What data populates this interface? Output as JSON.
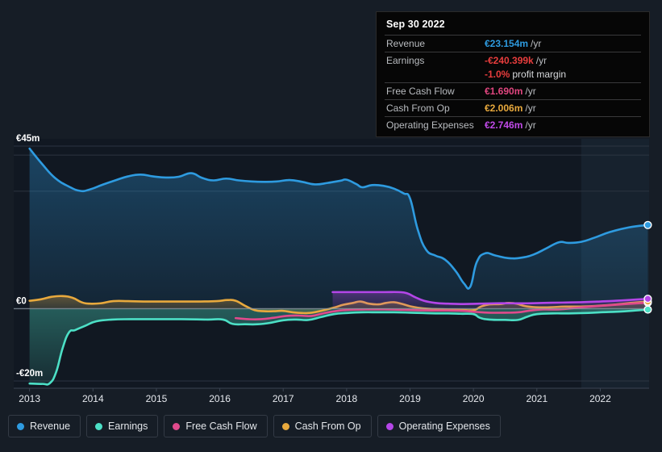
{
  "chart_data": {
    "type": "area",
    "title": "",
    "xlabel": "",
    "ylabel": "",
    "currency": "EUR",
    "grid": true,
    "legend_position": "bottom",
    "xlim": [
      2012.75,
      2022.77
    ],
    "ylim": [
      -22.0,
      47.0
    ],
    "y_ticks": [
      {
        "value": 45,
        "label": "€45m"
      },
      {
        "value": 0,
        "label": "€0"
      },
      {
        "value": -20,
        "label": "-€20m"
      }
    ],
    "gridline_values": [
      45,
      42.5,
      32.5,
      0,
      -20
    ],
    "x_ticks": [
      "2013",
      "2014",
      "2015",
      "2016",
      "2017",
      "2018",
      "2019",
      "2020",
      "2021",
      "2022"
    ],
    "forecast_region": {
      "start": 2021.7,
      "end": 2022.77
    },
    "series": [
      {
        "name": "Revenue",
        "key": "revenue",
        "color": "#2e9be0",
        "fill": true,
        "endpoint": true,
        "points": [
          [
            2013.0,
            44.3
          ],
          [
            2013.2,
            40.0
          ],
          [
            2013.4,
            36.2
          ],
          [
            2013.62,
            33.8
          ],
          [
            2013.8,
            32.6
          ],
          [
            2013.95,
            33.0
          ],
          [
            2014.15,
            34.3
          ],
          [
            2014.35,
            35.5
          ],
          [
            2014.55,
            36.6
          ],
          [
            2014.75,
            37.1
          ],
          [
            2014.95,
            36.6
          ],
          [
            2015.15,
            36.3
          ],
          [
            2015.35,
            36.5
          ],
          [
            2015.55,
            37.5
          ],
          [
            2015.72,
            36.2
          ],
          [
            2015.9,
            35.5
          ],
          [
            2016.1,
            36.0
          ],
          [
            2016.3,
            35.5
          ],
          [
            2016.5,
            35.2
          ],
          [
            2016.7,
            35.1
          ],
          [
            2016.9,
            35.2
          ],
          [
            2017.1,
            35.6
          ],
          [
            2017.3,
            35.1
          ],
          [
            2017.5,
            34.4
          ],
          [
            2017.7,
            34.8
          ],
          [
            2017.9,
            35.4
          ],
          [
            2018.0,
            35.7
          ],
          [
            2018.15,
            34.5
          ],
          [
            2018.25,
            33.6
          ],
          [
            2018.4,
            34.2
          ],
          [
            2018.58,
            34.0
          ],
          [
            2018.75,
            33.2
          ],
          [
            2018.9,
            31.9
          ],
          [
            2019.0,
            30.5
          ],
          [
            2019.12,
            22.0
          ],
          [
            2019.25,
            16.4
          ],
          [
            2019.4,
            14.7
          ],
          [
            2019.55,
            13.6
          ],
          [
            2019.72,
            10.4
          ],
          [
            2019.85,
            7.0
          ],
          [
            2019.95,
            6.1
          ],
          [
            2020.05,
            12.8
          ],
          [
            2020.18,
            15.3
          ],
          [
            2020.35,
            14.7
          ],
          [
            2020.55,
            14.0
          ],
          [
            2020.75,
            14.1
          ],
          [
            2020.95,
            15.0
          ],
          [
            2021.15,
            16.7
          ],
          [
            2021.35,
            18.4
          ],
          [
            2021.5,
            18.2
          ],
          [
            2021.7,
            18.5
          ],
          [
            2021.9,
            19.6
          ],
          [
            2022.15,
            21.2
          ],
          [
            2022.45,
            22.5
          ],
          [
            2022.75,
            23.154
          ]
        ]
      },
      {
        "name": "Earnings",
        "key": "earnings",
        "color": "#4ce0c6",
        "fill": true,
        "endpoint": true,
        "points": [
          [
            2013.0,
            -20.7
          ],
          [
            2013.2,
            -20.8
          ],
          [
            2013.32,
            -20.6
          ],
          [
            2013.42,
            -17.5
          ],
          [
            2013.52,
            -11.0
          ],
          [
            2013.62,
            -6.6
          ],
          [
            2013.72,
            -5.9
          ],
          [
            2013.88,
            -4.7
          ],
          [
            2014.05,
            -3.5
          ],
          [
            2014.3,
            -3.0
          ],
          [
            2014.6,
            -2.9
          ],
          [
            2015.0,
            -2.9
          ],
          [
            2015.4,
            -2.9
          ],
          [
            2015.8,
            -3.0
          ],
          [
            2016.05,
            -3.0
          ],
          [
            2016.2,
            -4.2
          ],
          [
            2016.4,
            -4.3
          ],
          [
            2016.6,
            -4.3
          ],
          [
            2016.8,
            -3.9
          ],
          [
            2017.0,
            -3.2
          ],
          [
            2017.2,
            -3.0
          ],
          [
            2017.4,
            -3.1
          ],
          [
            2017.6,
            -2.3
          ],
          [
            2017.8,
            -1.5
          ],
          [
            2018.0,
            -1.2
          ],
          [
            2018.25,
            -1.0
          ],
          [
            2018.5,
            -1.0
          ],
          [
            2018.75,
            -1.0
          ],
          [
            2019.0,
            -1.1
          ],
          [
            2019.2,
            -1.2
          ],
          [
            2019.4,
            -1.3
          ],
          [
            2019.6,
            -1.3
          ],
          [
            2019.8,
            -1.4
          ],
          [
            2020.0,
            -1.5
          ],
          [
            2020.1,
            -2.5
          ],
          [
            2020.25,
            -3.0
          ],
          [
            2020.5,
            -3.1
          ],
          [
            2020.7,
            -3.1
          ],
          [
            2020.85,
            -2.2
          ],
          [
            2021.0,
            -1.5
          ],
          [
            2021.25,
            -1.3
          ],
          [
            2021.5,
            -1.3
          ],
          [
            2021.75,
            -1.2
          ],
          [
            2022.0,
            -1.0
          ],
          [
            2022.3,
            -0.8
          ],
          [
            2022.55,
            -0.5
          ],
          [
            2022.75,
            -0.240399
          ]
        ]
      },
      {
        "name": "Free Cash Flow",
        "key": "free_cash_flow",
        "color": "#e04a8c",
        "fill": false,
        "endpoint": true,
        "points": [
          [
            2016.25,
            -2.6
          ],
          [
            2016.45,
            -2.9
          ],
          [
            2016.65,
            -2.9
          ],
          [
            2016.85,
            -2.5
          ],
          [
            2017.05,
            -2.0
          ],
          [
            2017.25,
            -1.9
          ],
          [
            2017.45,
            -2.0
          ],
          [
            2017.65,
            -1.2
          ],
          [
            2017.85,
            -0.6
          ],
          [
            2018.05,
            -0.3
          ],
          [
            2018.3,
            -0.2
          ],
          [
            2018.6,
            -0.2
          ],
          [
            2018.85,
            -0.3
          ],
          [
            2019.1,
            -0.4
          ],
          [
            2019.35,
            -0.5
          ],
          [
            2019.6,
            -0.5
          ],
          [
            2019.85,
            -0.6
          ],
          [
            2020.05,
            -0.9
          ],
          [
            2020.25,
            -1.1
          ],
          [
            2020.5,
            -1.1
          ],
          [
            2020.7,
            -1.0
          ],
          [
            2020.9,
            -0.5
          ],
          [
            2021.1,
            -0.2
          ],
          [
            2021.35,
            -0.2
          ],
          [
            2021.6,
            0.2
          ],
          [
            2021.85,
            0.6
          ],
          [
            2022.1,
            0.9
          ],
          [
            2022.4,
            1.3
          ],
          [
            2022.75,
            1.69
          ]
        ]
      },
      {
        "name": "Cash From Op",
        "key": "cash_from_op",
        "color": "#e8a93d",
        "fill": true,
        "endpoint": true,
        "points": [
          [
            2013.0,
            2.2
          ],
          [
            2013.18,
            2.6
          ],
          [
            2013.35,
            3.3
          ],
          [
            2013.52,
            3.5
          ],
          [
            2013.68,
            3.0
          ],
          [
            2013.82,
            1.8
          ],
          [
            2013.95,
            1.4
          ],
          [
            2014.12,
            1.5
          ],
          [
            2014.32,
            2.1
          ],
          [
            2014.55,
            2.1
          ],
          [
            2014.8,
            2.0
          ],
          [
            2015.1,
            2.0
          ],
          [
            2015.4,
            2.0
          ],
          [
            2015.7,
            2.0
          ],
          [
            2015.95,
            2.1
          ],
          [
            2016.12,
            2.4
          ],
          [
            2016.25,
            2.2
          ],
          [
            2016.4,
            0.8
          ],
          [
            2016.55,
            -0.4
          ],
          [
            2016.7,
            -0.7
          ],
          [
            2016.85,
            -0.7
          ],
          [
            2017.0,
            -0.6
          ],
          [
            2017.15,
            -1.0
          ],
          [
            2017.3,
            -1.2
          ],
          [
            2017.45,
            -1.1
          ],
          [
            2017.62,
            -0.5
          ],
          [
            2017.8,
            0.3
          ],
          [
            2017.95,
            1.1
          ],
          [
            2018.1,
            1.6
          ],
          [
            2018.22,
            2.0
          ],
          [
            2018.35,
            1.4
          ],
          [
            2018.5,
            1.2
          ],
          [
            2018.62,
            1.6
          ],
          [
            2018.75,
            1.8
          ],
          [
            2018.88,
            1.3
          ],
          [
            2019.02,
            0.6
          ],
          [
            2019.2,
            0.1
          ],
          [
            2019.4,
            -0.1
          ],
          [
            2019.6,
            -0.2
          ],
          [
            2019.8,
            -0.3
          ],
          [
            2020.0,
            -0.4
          ],
          [
            2020.12,
            0.6
          ],
          [
            2020.25,
            1.2
          ],
          [
            2020.42,
            1.3
          ],
          [
            2020.55,
            1.6
          ],
          [
            2020.68,
            1.4
          ],
          [
            2020.82,
            0.7
          ],
          [
            2021.0,
            0.4
          ],
          [
            2021.2,
            0.4
          ],
          [
            2021.45,
            0.6
          ],
          [
            2021.7,
            0.6
          ],
          [
            2021.95,
            0.8
          ],
          [
            2022.2,
            1.1
          ],
          [
            2022.48,
            1.6
          ],
          [
            2022.75,
            2.006
          ]
        ]
      },
      {
        "name": "Operating Expenses",
        "key": "operating_expenses",
        "color": "#b446e8",
        "fill": true,
        "endpoint": true,
        "points": [
          [
            2017.78,
            4.6
          ],
          [
            2018.0,
            4.6
          ],
          [
            2018.3,
            4.6
          ],
          [
            2018.6,
            4.6
          ],
          [
            2018.82,
            4.6
          ],
          [
            2018.95,
            4.3
          ],
          [
            2019.08,
            3.2
          ],
          [
            2019.22,
            2.2
          ],
          [
            2019.4,
            1.6
          ],
          [
            2019.6,
            1.4
          ],
          [
            2019.85,
            1.3
          ],
          [
            2020.1,
            1.4
          ],
          [
            2020.35,
            1.5
          ],
          [
            2020.6,
            1.5
          ],
          [
            2020.85,
            1.5
          ],
          [
            2021.1,
            1.6
          ],
          [
            2021.4,
            1.7
          ],
          [
            2021.7,
            1.8
          ],
          [
            2022.0,
            2.0
          ],
          [
            2022.35,
            2.3
          ],
          [
            2022.75,
            2.746
          ]
        ]
      }
    ]
  },
  "tooltip": {
    "title": "Sep 30 2022",
    "rows": [
      {
        "label": "Revenue",
        "value": "€23.154m",
        "unit": "/yr",
        "color": "#2e9be0"
      },
      {
        "label": "Earnings",
        "value": "-€240.399k",
        "unit": "/yr",
        "color": "#e83d3d"
      },
      {
        "label": "",
        "value": "-1.0%",
        "suffix": "profit margin",
        "color": "#e83d3d"
      },
      {
        "label": "Free Cash Flow",
        "value": "€1.690m",
        "unit": "/yr",
        "color": "#e0467f"
      },
      {
        "label": "Cash From Op",
        "value": "€2.006m",
        "unit": "/yr",
        "color": "#e8a93d"
      },
      {
        "label": "Operating Expenses",
        "value": "€2.746m",
        "unit": "/yr",
        "color": "#c04ae8"
      }
    ]
  },
  "legend": {
    "items": [
      {
        "label": "Revenue",
        "color": "#2e9be0"
      },
      {
        "label": "Earnings",
        "color": "#4ce0c6"
      },
      {
        "label": "Free Cash Flow",
        "color": "#e04a8c"
      },
      {
        "label": "Cash From Op",
        "color": "#e8a93d"
      },
      {
        "label": "Operating Expenses",
        "color": "#b446e8"
      }
    ]
  },
  "theme": {
    "background": "#161d26",
    "plot_background": "#111822",
    "gridline": "#2c3541",
    "zero_line": "#8f9aa6",
    "axis_line": "#3b4452",
    "forecast_band": "#17222e"
  }
}
